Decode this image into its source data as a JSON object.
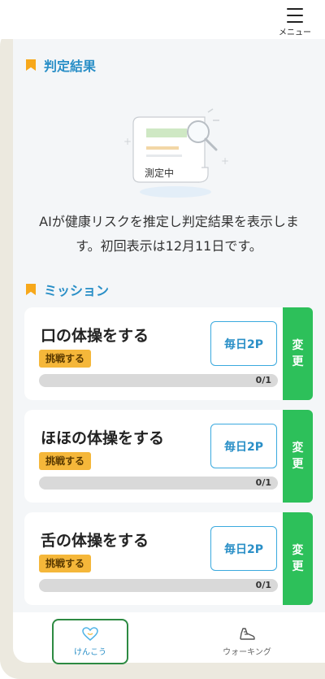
{
  "menu": {
    "label": "メニュー"
  },
  "judgement": {
    "title": "判定結果",
    "status": "測定中",
    "description_line1": "AIが健康リスクを推定し判定結果を表示しま",
    "description_line2": "す。初回表示は12月11日です。"
  },
  "missions": {
    "title": "ミッション",
    "items": [
      {
        "title": "口の体操をする",
        "challenge_label": "挑戦する",
        "points_label": "毎日2P",
        "progress_text": "0/1",
        "progress": 0,
        "change_label_1": "変",
        "change_label_2": "更"
      },
      {
        "title": "ほほの体操をする",
        "challenge_label": "挑戦する",
        "points_label": "毎日2P",
        "progress_text": "0/1",
        "progress": 0,
        "change_label_1": "変",
        "change_label_2": "更"
      },
      {
        "title": "舌の体操をする",
        "challenge_label": "挑戦する",
        "points_label": "毎日2P",
        "progress_text": "0/1",
        "progress": 0,
        "change_label_1": "変",
        "change_label_2": "更"
      }
    ]
  },
  "nav": {
    "items": [
      {
        "label": "けんこう",
        "icon": "heart-icon",
        "active": true
      },
      {
        "label": "ウォーキング",
        "icon": "shoe-icon",
        "active": false
      }
    ]
  },
  "colors": {
    "accent_blue": "#2a8fc7",
    "accent_orange": "#f5b73a",
    "change_green": "#2dc05a",
    "nav_active_border": "#2d8a42"
  }
}
